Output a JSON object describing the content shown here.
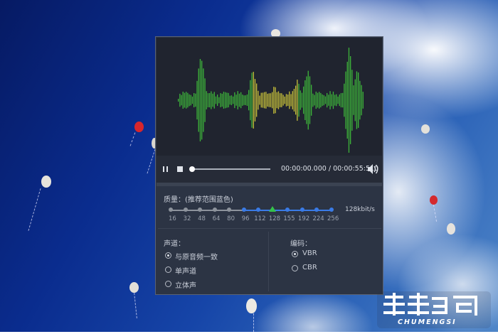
{
  "time": {
    "current": "00:00:00.000",
    "separator": " / ",
    "total": "00:00:55:510"
  },
  "quality": {
    "label": "质量：(推荐范围蓝色)",
    "value_label": "128kbit/s",
    "ticks": [
      "16",
      "32",
      "48",
      "64",
      "80",
      "96",
      "112",
      "128",
      "155",
      "192",
      "224",
      "256"
    ],
    "recommended_range": [
      "96",
      "256"
    ],
    "selected": "128"
  },
  "channel": {
    "label": "声道：",
    "options": [
      "与原音频一致",
      "单声道",
      "立体声"
    ],
    "selected": "与原音频一致"
  },
  "encoding": {
    "label": "编码：",
    "options": [
      "VBR",
      "CBR"
    ],
    "selected": "VBR"
  },
  "watermark": {
    "name": "楚梦",
    "domain": "CHUMENGSI"
  },
  "colors": {
    "accent": "#3a7be6",
    "wave_green": "#3db43a",
    "wave_yellow": "#c8c23a",
    "marker": "#35c24a"
  },
  "icons": [
    "pause-icon",
    "stop-icon",
    "volume-icon"
  ]
}
